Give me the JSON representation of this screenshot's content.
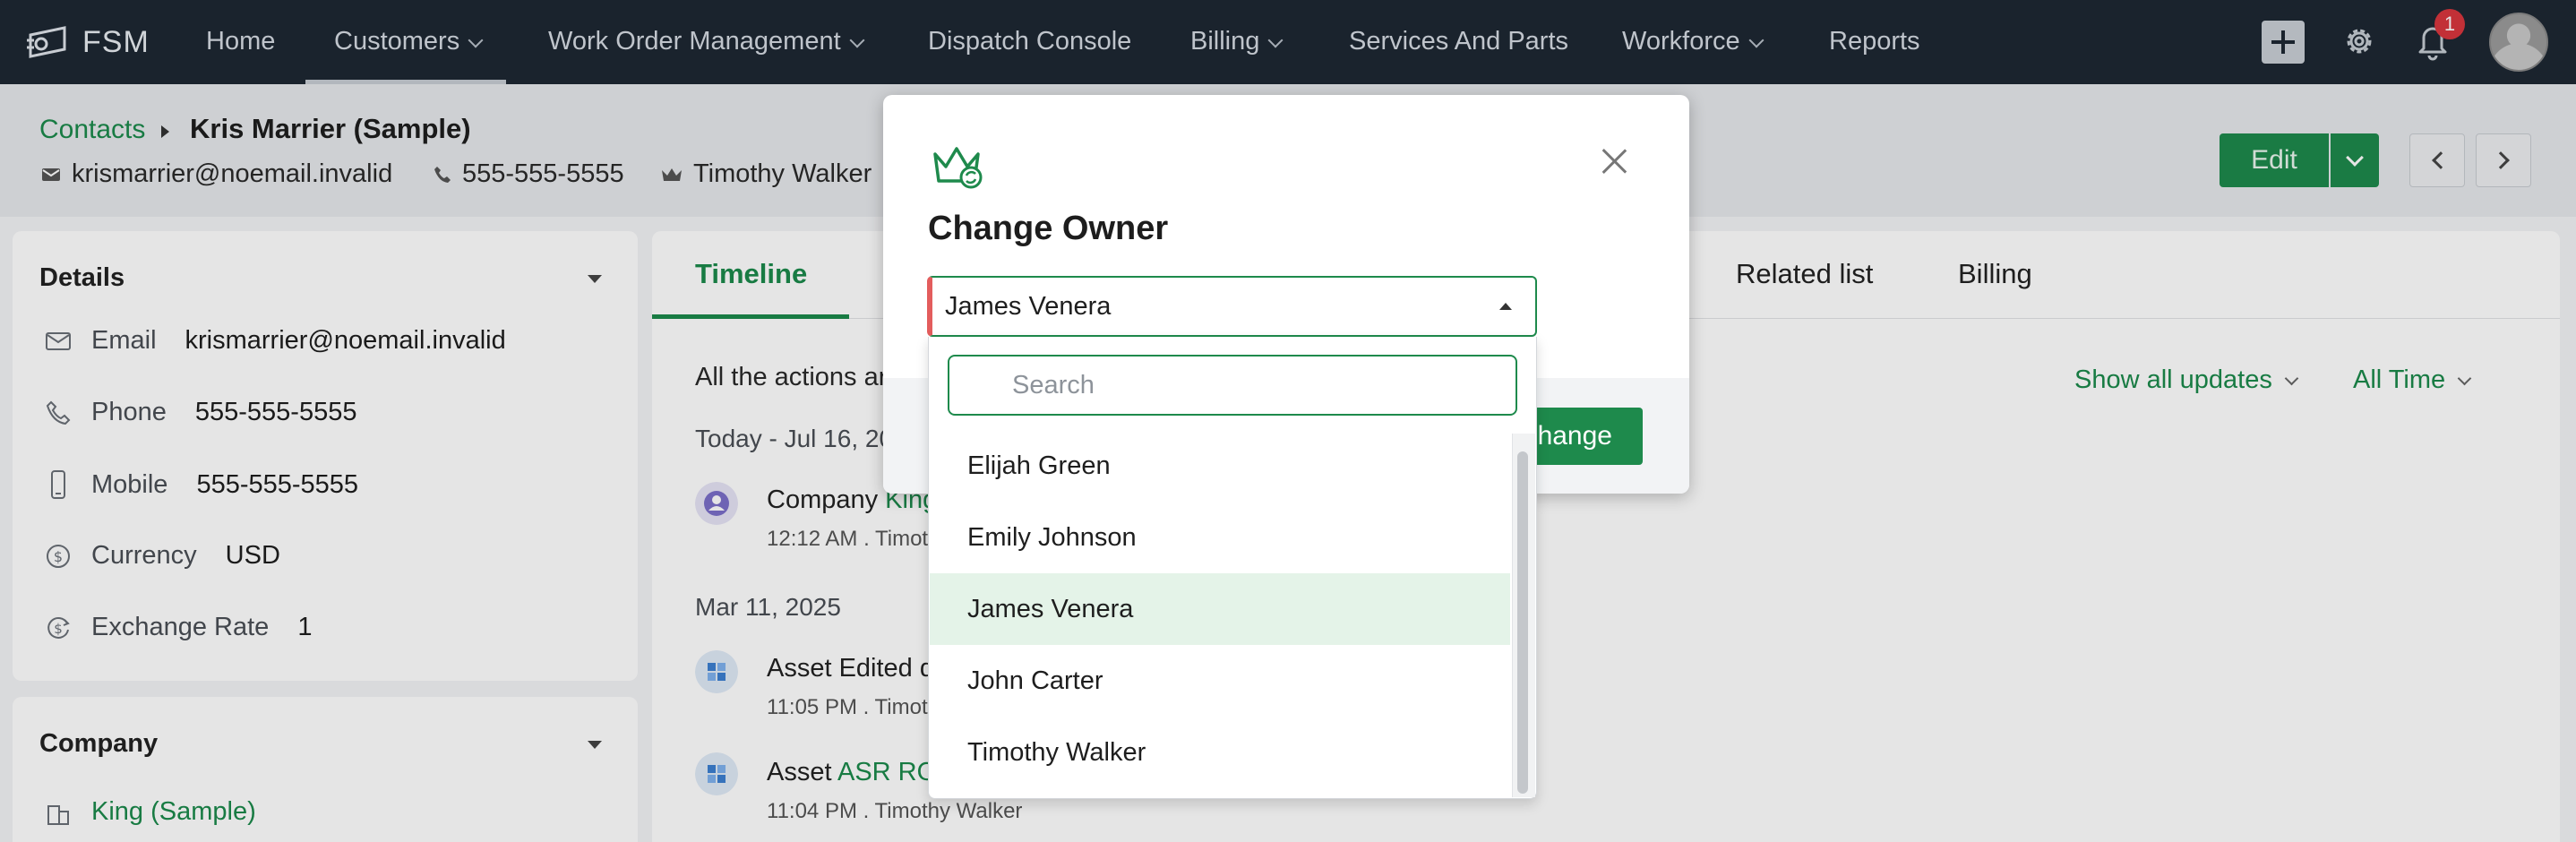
{
  "nav": {
    "brand": "FSM",
    "items": [
      {
        "label": "Home"
      },
      {
        "label": "Customers"
      },
      {
        "label": "Work Order Management"
      },
      {
        "label": "Dispatch Console"
      },
      {
        "label": "Billing"
      },
      {
        "label": "Services And Parts"
      },
      {
        "label": "Workforce"
      },
      {
        "label": "Reports"
      }
    ],
    "notification_count": "1"
  },
  "header": {
    "breadcrumb_link": "Contacts",
    "title": "Kris Marrier (Sample)",
    "email": "krismarrier@noemail.invalid",
    "phone": "555-555-5555",
    "owner": "Timothy Walker",
    "edit_label": "Edit"
  },
  "details": {
    "title": "Details",
    "fields": [
      {
        "label": "Email",
        "value": "krismarrier@noemail.invalid",
        "icon": "mail-icon"
      },
      {
        "label": "Phone",
        "value": "555-555-5555",
        "icon": "phone-icon"
      },
      {
        "label": "Mobile",
        "value": "555-555-5555",
        "icon": "mobile-icon"
      },
      {
        "label": "Currency",
        "value": "USD",
        "icon": "currency-icon"
      },
      {
        "label": "Exchange Rate",
        "value": "1",
        "icon": "exchange-rate-icon"
      }
    ]
  },
  "company": {
    "title": "Company",
    "name": "King (Sample)"
  },
  "tabs": {
    "timeline": "Timeline",
    "related": "Related list",
    "billing": "Billing"
  },
  "timeline": {
    "intro": "All the actions ar",
    "filter_updates": "Show all updates",
    "filter_time": "All Time",
    "groups": [
      {
        "date": "Today - Jul 16, 20"
      },
      {
        "date": "Mar 11, 2025"
      }
    ],
    "entries": [
      {
        "prefix": "Company ",
        "link": "King",
        "sub": "12:12 AM . Timoth"
      },
      {
        "prefix": "Asset Edited d",
        "link": "",
        "sub": "11:05 PM . Timot"
      },
      {
        "prefix": "Asset ",
        "link": "ASR RO",
        "sub": "11:04 PM . Timothy Walker"
      }
    ]
  },
  "modal": {
    "title": "Change Owner",
    "selected": "James Venera",
    "search_placeholder": "Search",
    "submit_label": "hange",
    "options": [
      "Elijah Green",
      "Emily Johnson",
      "James Venera",
      "John Carter",
      "Timothy Walker"
    ]
  },
  "colors": {
    "accent": "#1e8a4c",
    "nav_bg": "#1d2733",
    "selected_row": "#e4f3e8",
    "required_marker": "#e35d5d"
  }
}
